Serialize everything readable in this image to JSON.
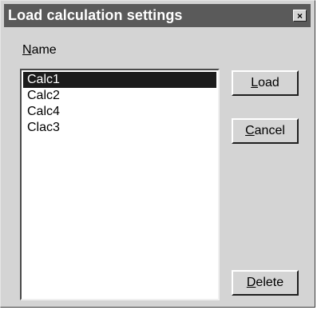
{
  "dialog": {
    "title": "Load calculation settings",
    "close_glyph": "×",
    "name_label_mnemonic": "N",
    "name_label_rest": "ame"
  },
  "list": {
    "items": [
      "Calc1",
      "Calc2",
      "Calc4",
      "Clac3"
    ],
    "selected": "Calc1"
  },
  "buttons": {
    "load": {
      "mnemonic": "L",
      "rest": "oad"
    },
    "cancel": {
      "mnemonic": "C",
      "rest": "ancel"
    },
    "delete": {
      "mnemonic": "D",
      "rest": "elete"
    }
  }
}
